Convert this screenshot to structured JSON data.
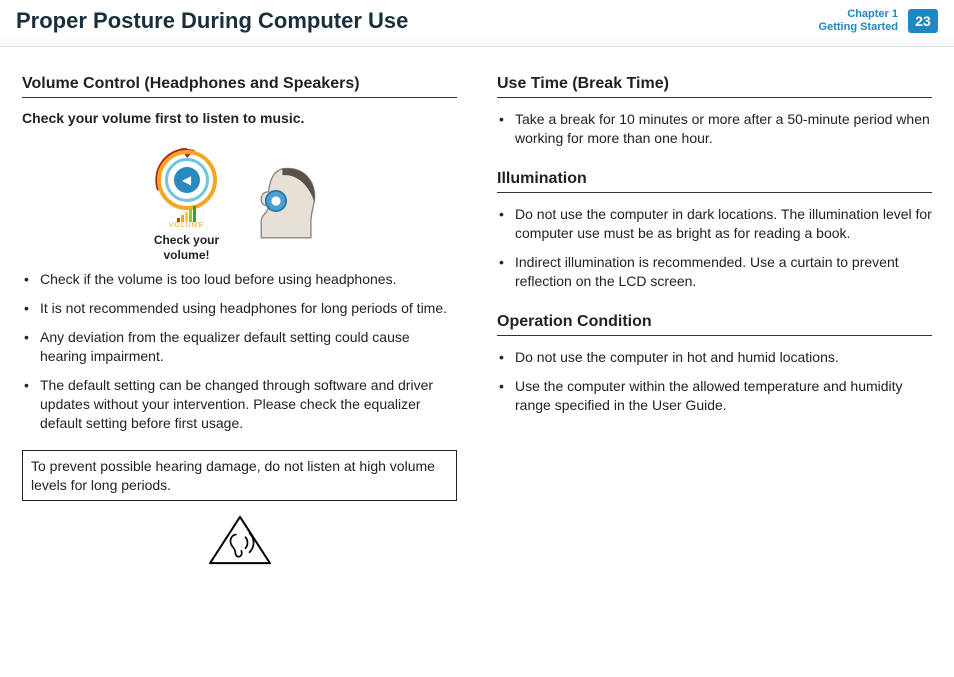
{
  "header": {
    "title": "Proper Posture During Computer Use",
    "chapter_line1": "Chapter 1",
    "chapter_line2": "Getting Started",
    "page_number": "23"
  },
  "left": {
    "section_title": "Volume Control (Headphones and Speakers)",
    "subtitle": "Check your volume first to listen to music.",
    "figure_caption_line1": "Check your",
    "figure_caption_line2": "volume!",
    "volume_word": "VOLUME",
    "bullets": [
      "Check if the volume is too loud before using headphones.",
      "It is not recommended using headphones for long periods of time.",
      "Any deviation from the equalizer default setting could cause hearing impairment.",
      "The default setting can be changed through software and driver updates without your intervention. Please check the equalizer default setting before first usage."
    ],
    "warning": "To prevent possible hearing damage, do not listen at high volume levels for long periods."
  },
  "right": {
    "section1_title": "Use Time (Break Time)",
    "section1_bullets": [
      "Take a break for 10 minutes or more after a 50-minute period when working for more than one hour."
    ],
    "section2_title": "Illumination",
    "section2_bullets": [
      "Do not use the computer in dark locations. The illumination level for computer use must be as bright as for reading a book.",
      "Indirect illumination is recommended. Use a curtain to prevent reflection on the LCD screen."
    ],
    "section3_title": "Operation Condition",
    "section3_bullets": [
      "Do not use the computer in hot and humid locations.",
      "Use the computer within the allowed temperature and humidity range specified in the User Guide."
    ]
  }
}
